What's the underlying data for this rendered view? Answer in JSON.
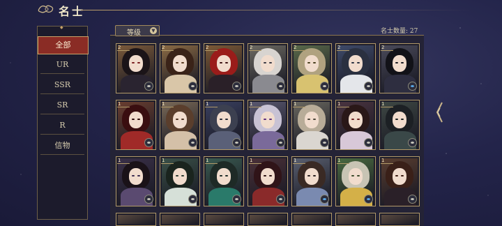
{
  "header": {
    "title": "名士"
  },
  "sidebar": {
    "items": [
      {
        "label": "全部",
        "active": true
      },
      {
        "label": "UR"
      },
      {
        "label": "SSR"
      },
      {
        "label": "SR"
      },
      {
        "label": "R"
      },
      {
        "label": "信物"
      }
    ]
  },
  "filter": {
    "label": "等级"
  },
  "count_label": "名士数量: 27",
  "colors": {
    "accent_red": "#8a2c25",
    "gold": "#b29a68",
    "panel": "#242336"
  },
  "cards": [
    {
      "tag": "2",
      "bg": "#7b5a3a",
      "hair": "#1b1418",
      "robe": "#2a2430",
      "eye": "#7a1e20"
    },
    {
      "tag": "2",
      "bg": "#8a6a44",
      "hair": "#3a2318",
      "robe": "#d9c6a8",
      "eye": "#5a3a20"
    },
    {
      "tag": "2",
      "bg": "#7d5a36",
      "hair": "#9a1c1a",
      "robe": "#2a2028",
      "eye": "#3a1010"
    },
    {
      "tag": "2",
      "bg": "#6d6a62",
      "hair": "#d8d4d0",
      "robe": "#8a8a90",
      "eye": "#3a3a44"
    },
    {
      "tag": "2",
      "bg": "#5a6a4a",
      "hair": "#b0a280",
      "robe": "#d8c270",
      "eye": "#4a4020"
    },
    {
      "tag": "2",
      "bg": "#3e4a6a",
      "hair": "#2a3040",
      "robe": "#e4e6ea",
      "eye": "#283040"
    },
    {
      "tag": "2",
      "bg": "#4a4a5a",
      "hair": "#121218",
      "robe": "#2e2e40",
      "eye": "#181820",
      "blue": true
    },
    {
      "tag": "1",
      "bg": "#6a3e30",
      "hair": "#3a0e10",
      "robe": "#a02a28",
      "eye": "#2a0a0a"
    },
    {
      "tag": "1",
      "bg": "#7a6a58",
      "hair": "#5a3e2c",
      "robe": "#d4c0a8",
      "eye": "#4a3020"
    },
    {
      "tag": "1",
      "bg": "#3a4060",
      "hair": "#3c4050",
      "robe": "#5a6078",
      "eye": "#202430"
    },
    {
      "tag": "1",
      "bg": "#5a5870",
      "hair": "#c8c2d4",
      "robe": "#7a6a9a",
      "eye": "#5a2a7a"
    },
    {
      "tag": "1",
      "bg": "#6a6860",
      "hair": "#b8ac98",
      "robe": "#dad6d0",
      "eye": "#4a4438"
    },
    {
      "tag": "1",
      "bg": "#4a3440",
      "hair": "#2a1818",
      "robe": "#d8c8d8",
      "eye": "#6a2020"
    },
    {
      "tag": "1",
      "bg": "#3e4844",
      "hair": "#1c2024",
      "robe": "#3a4848",
      "eye": "#1a2020"
    },
    {
      "tag": "1",
      "bg": "#3a3048",
      "hair": "#1a1218",
      "robe": "#5a4a70",
      "eye": "#3a2a50"
    },
    {
      "tag": "1",
      "bg": "#3a5048",
      "hair": "#1a241e",
      "robe": "#d6e0d8",
      "eye": "#2a3a30"
    },
    {
      "tag": "1",
      "bg": "#3a5a50",
      "hair": "#1e2a26",
      "robe": "#2a7a6a",
      "eye": "#1a2a26"
    },
    {
      "tag": "1",
      "bg": "#4a3038",
      "hair": "#301418",
      "robe": "#8a2a2a",
      "eye": "#2a1010"
    },
    {
      "tag": "1",
      "bg": "#5a6070",
      "hair": "#3a2a24",
      "robe": "#7a8ab0",
      "eye": "#2a2020",
      "blue": true
    },
    {
      "tag": "1",
      "bg": "#4a6a40",
      "hair": "#c8c4b4",
      "robe": "#d4b048",
      "eye": "#3a4a2a",
      "blue": true
    },
    {
      "tag": "1",
      "bg": "#5a3e30",
      "hair": "#3a2018",
      "robe": "#2a2028",
      "eye": "#3a1a10"
    }
  ]
}
